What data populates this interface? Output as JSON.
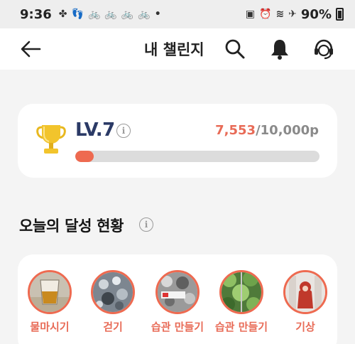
{
  "status_bar": {
    "time": "9:36",
    "battery": "90%"
  },
  "header": {
    "title": "내 챌린지",
    "icons": [
      "back-arrow-icon",
      "search-icon",
      "bell-icon",
      "support-headset-icon"
    ]
  },
  "level": {
    "label": "LV.7",
    "points_current": "7,553",
    "points_total": "/10,000p",
    "progress_fraction": 0.07553
  },
  "section": {
    "title": "오늘의 달성 현황"
  },
  "challenges": [
    {
      "label": "물마시기"
    },
    {
      "label": "걷기"
    },
    {
      "label": "습관 만들기"
    },
    {
      "label": "습관 만들기"
    },
    {
      "label": "기상"
    }
  ],
  "colors": {
    "accent": "#ee6a50",
    "level_text": "#2b3a66",
    "background": "#f4f4f4"
  }
}
